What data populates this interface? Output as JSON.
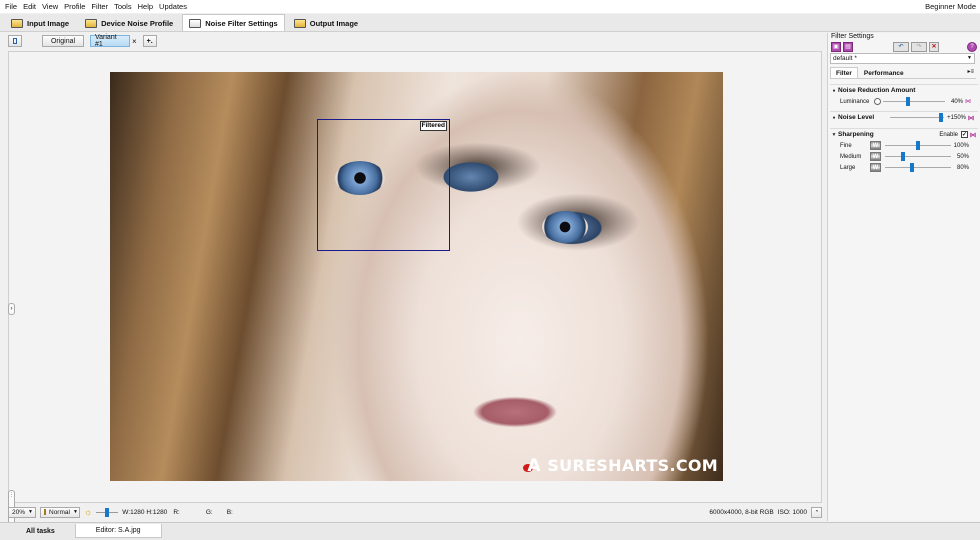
{
  "menu": {
    "items": [
      "File",
      "Edit",
      "View",
      "Profile",
      "Filter",
      "Tools",
      "Help",
      "Updates"
    ],
    "mode": "Beginner Mode"
  },
  "steps": [
    {
      "label": "Input Image",
      "icon": "image-icon"
    },
    {
      "label": "Device Noise Profile",
      "icon": "camera-profile-icon"
    },
    {
      "label": "Noise Filter Settings",
      "icon": "filter-settings-icon"
    },
    {
      "label": "Output Image",
      "icon": "output-image-icon"
    }
  ],
  "active_step": 2,
  "editor": {
    "variant_tabs": [
      "Original",
      "Variant #1"
    ],
    "active_variant": 1,
    "close_glyph": "×",
    "add_glyph": "+.",
    "filtered_label": "Filtered",
    "watermark_text": "SURESHARTS.COM",
    "watermark_mark": "A"
  },
  "statusbar": {
    "zoom": "20%",
    "mode": "Normal",
    "size_readout": "W:1280 H:1280",
    "r_label": "R:",
    "g_label": "G:",
    "b_label": "B:",
    "image_info": "6000x4000, 8-bit RGB",
    "iso": "ISO: 1000"
  },
  "doctabs": [
    "All tasks",
    "Editor: S.A.jpg"
  ],
  "panel": {
    "title": "Filter Settings",
    "preset": "default *",
    "tabs": [
      "Filter",
      "Performance"
    ],
    "sections": {
      "noise_reduction": {
        "title": "Noise Reduction Amount",
        "rows": [
          {
            "label": "Luminance",
            "value": "40%",
            "fraction": 0.4
          }
        ]
      },
      "noise_level": {
        "title": "Noise Level",
        "value": "+150%",
        "fraction": 0.97
      },
      "sharpening": {
        "title": "Sharpening",
        "enable_label": "Enable",
        "enabled": true,
        "rows": [
          {
            "label": "Fine",
            "value": "100%",
            "fraction": 0.5
          },
          {
            "label": "Medium",
            "value": "50%",
            "fraction": 0.25
          },
          {
            "label": "Large",
            "value": "80%",
            "fraction": 0.4
          }
        ]
      }
    }
  }
}
